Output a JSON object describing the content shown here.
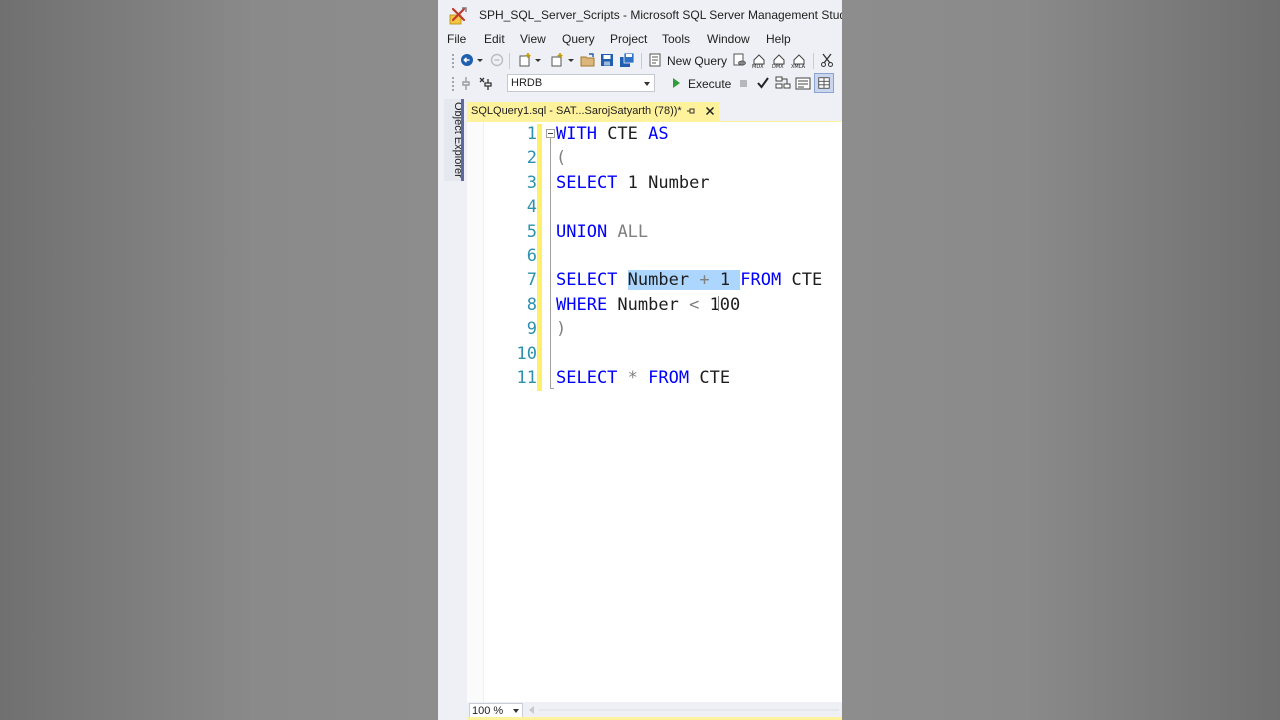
{
  "window": {
    "title": "SPH_SQL_Server_Scripts - Microsoft SQL Server Management Studio"
  },
  "menu": [
    "File",
    "Edit",
    "View",
    "Query",
    "Project",
    "Tools",
    "Window",
    "Help"
  ],
  "toolbar": {
    "new_query_label": "New Query",
    "database": "HRDB",
    "execute_label": "Execute",
    "icons": [
      "back-icon",
      "forward-icon",
      "new-project-icon",
      "new-item-icon",
      "open-file-icon",
      "save-icon",
      "save-all-icon",
      "new-query-icon",
      "mdx-icon",
      "dmx-icon",
      "xmla-icon",
      "dax-icon",
      "cut-icon",
      "connect-icon",
      "change-connection-icon",
      "execute-icon",
      "stop-icon",
      "parse-icon",
      "display-plan-icon",
      "results-to-text-icon",
      "results-to-grid-icon"
    ]
  },
  "sidebar": {
    "object_explorer_label": "Object Explorer"
  },
  "document_tab": {
    "label": "SQLQuery1.sql - SAT...SarojSatyarth (78))*"
  },
  "editor": {
    "line_numbers": [
      "1",
      "2",
      "3",
      "4",
      "5",
      "6",
      "7",
      "8",
      "9",
      "10",
      "11"
    ],
    "lines": [
      [
        {
          "t": "WITH",
          "c": "kw"
        },
        {
          "t": " CTE ",
          "c": ""
        },
        {
          "t": "AS",
          "c": "kw"
        }
      ],
      [
        {
          "t": "(",
          "c": "gray"
        }
      ],
      [
        {
          "t": "SELECT",
          "c": "kw"
        },
        {
          "t": " 1 Number",
          "c": ""
        }
      ],
      [],
      [
        {
          "t": "UNION",
          "c": "kw"
        },
        {
          "t": " ",
          "c": ""
        },
        {
          "t": "ALL",
          "c": "gray"
        }
      ],
      [],
      [
        {
          "t": "SELECT",
          "c": "kw"
        },
        {
          "t": " ",
          "c": ""
        },
        {
          "t": "Number ",
          "c": "sel"
        },
        {
          "t": "+",
          "c": "sel gray"
        },
        {
          "t": " 1 ",
          "c": "sel"
        },
        {
          "t": "FROM",
          "c": "kw"
        },
        {
          "t": " CTE",
          "c": ""
        }
      ],
      [
        {
          "t": "WHERE",
          "c": "kw"
        },
        {
          "t": " Number ",
          "c": ""
        },
        {
          "t": "<",
          "c": "gray"
        },
        {
          "t": " 100",
          "c": ""
        }
      ],
      [
        {
          "t": ")",
          "c": "gray"
        }
      ],
      [],
      [
        {
          "t": "SELECT",
          "c": "kw"
        },
        {
          "t": " ",
          "c": ""
        },
        {
          "t": "*",
          "c": "gray"
        },
        {
          "t": " ",
          "c": ""
        },
        {
          "t": "FROM",
          "c": "kw"
        },
        {
          "t": " CTE",
          "c": ""
        }
      ]
    ]
  },
  "status": {
    "zoom": "100 %"
  },
  "colors": {
    "keyword": "#0000ff",
    "operator": "#808080",
    "line_number": "#2b91af",
    "selection": "#add6ff",
    "active_tab": "#fff29d"
  }
}
